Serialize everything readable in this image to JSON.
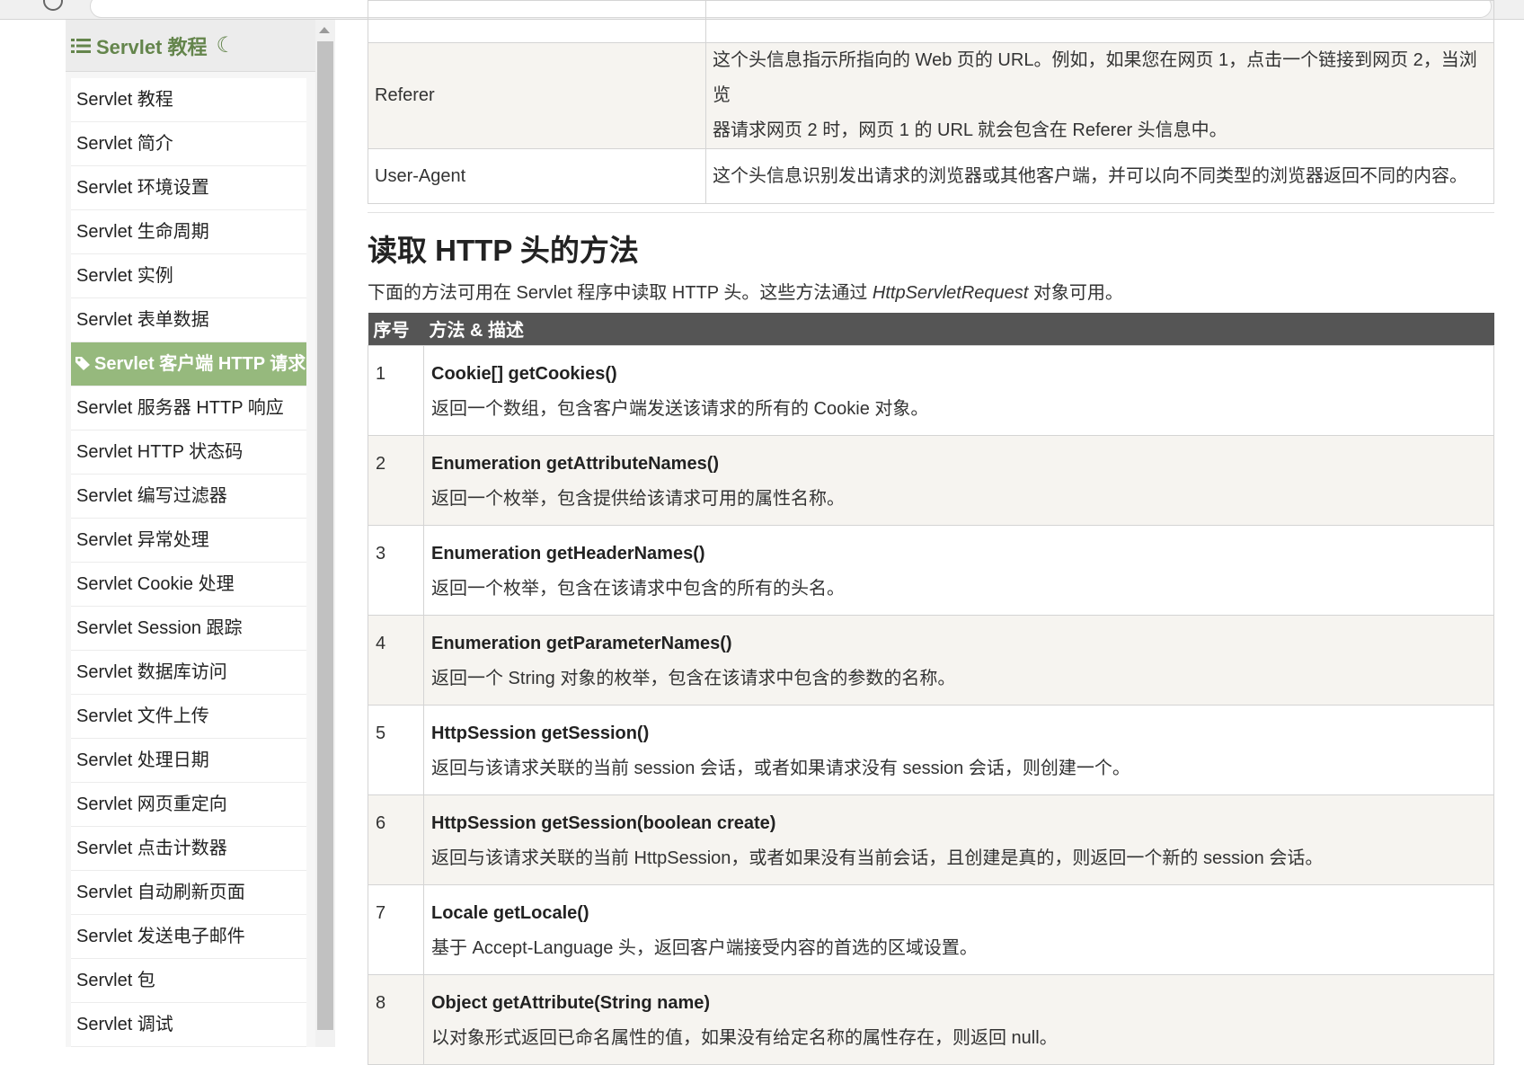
{
  "sidebar": {
    "title": "Servlet 教程",
    "items": [
      {
        "label": "Servlet 教程",
        "active": false
      },
      {
        "label": "Servlet 简介",
        "active": false
      },
      {
        "label": "Servlet 环境设置",
        "active": false
      },
      {
        "label": "Servlet 生命周期",
        "active": false
      },
      {
        "label": "Servlet 实例",
        "active": false
      },
      {
        "label": "Servlet 表单数据",
        "active": false
      },
      {
        "label": "Servlet 客户端 HTTP 请求",
        "active": true
      },
      {
        "label": "Servlet 服务器 HTTP 响应",
        "active": false
      },
      {
        "label": "Servlet HTTP 状态码",
        "active": false
      },
      {
        "label": "Servlet 编写过滤器",
        "active": false
      },
      {
        "label": "Servlet 异常处理",
        "active": false
      },
      {
        "label": "Servlet Cookie 处理",
        "active": false
      },
      {
        "label": "Servlet Session 跟踪",
        "active": false
      },
      {
        "label": "Servlet 数据库访问",
        "active": false
      },
      {
        "label": "Servlet 文件上传",
        "active": false
      },
      {
        "label": "Servlet 处理日期",
        "active": false
      },
      {
        "label": "Servlet 网页重定向",
        "active": false
      },
      {
        "label": "Servlet 点击计数器",
        "active": false
      },
      {
        "label": "Servlet 自动刷新页面",
        "active": false
      },
      {
        "label": "Servlet 发送电子邮件",
        "active": false
      },
      {
        "label": "Servlet 包",
        "active": false
      },
      {
        "label": "Servlet 调试",
        "active": false
      }
    ]
  },
  "header_table": [
    {
      "name": "Referer",
      "desc_line1": "这个头信息指示所指向的 Web 页的 URL。例如，如果您在网页 1，点击一个链接到网页 2，当浏览",
      "desc_line2": "器请求网页 2 时，网页 1 的 URL 就会包含在 Referer 头信息中。"
    },
    {
      "name": "User-Agent",
      "desc_line1": "这个头信息识别发出请求的浏览器或其他客户端，并可以向不同类型的浏览器返回不同的内容。",
      "desc_line2": ""
    }
  ],
  "section": {
    "title": "读取 HTTP 头的方法",
    "intro_before": "下面的方法可用在 Servlet 程序中读取 HTTP 头。这些方法通过 ",
    "intro_em": "HttpServletRequest",
    "intro_after": " 对象可用。"
  },
  "methods_table": {
    "col_num": "序号",
    "col_desc": "方法 & 描述",
    "rows": [
      {
        "num": "1",
        "name": "Cookie[] getCookies()",
        "desc": "返回一个数组，包含客户端发送该请求的所有的 Cookie 对象。"
      },
      {
        "num": "2",
        "name": "Enumeration getAttributeNames()",
        "desc": "返回一个枚举，包含提供给该请求可用的属性名称。"
      },
      {
        "num": "3",
        "name": "Enumeration getHeaderNames()",
        "desc": "返回一个枚举，包含在该请求中包含的所有的头名。"
      },
      {
        "num": "4",
        "name": "Enumeration getParameterNames()",
        "desc": "返回一个 String 对象的枚举，包含在该请求中包含的参数的名称。"
      },
      {
        "num": "5",
        "name": "HttpSession getSession()",
        "desc": "返回与该请求关联的当前 session 会话，或者如果请求没有 session 会话，则创建一个。"
      },
      {
        "num": "6",
        "name": "HttpSession getSession(boolean create)",
        "desc": "返回与该请求关联的当前 HttpSession，或者如果没有当前会话，且创建是真的，则返回一个新的 session 会话。"
      },
      {
        "num": "7",
        "name": "Locale getLocale()",
        "desc": "基于 Accept-Language 头，返回客户端接受内容的首选的区域设置。"
      },
      {
        "num": "8",
        "name": "Object getAttribute(String name)",
        "desc": "以对象形式返回已命名属性的值，如果没有给定名称的属性存在，则返回 null。"
      }
    ]
  }
}
